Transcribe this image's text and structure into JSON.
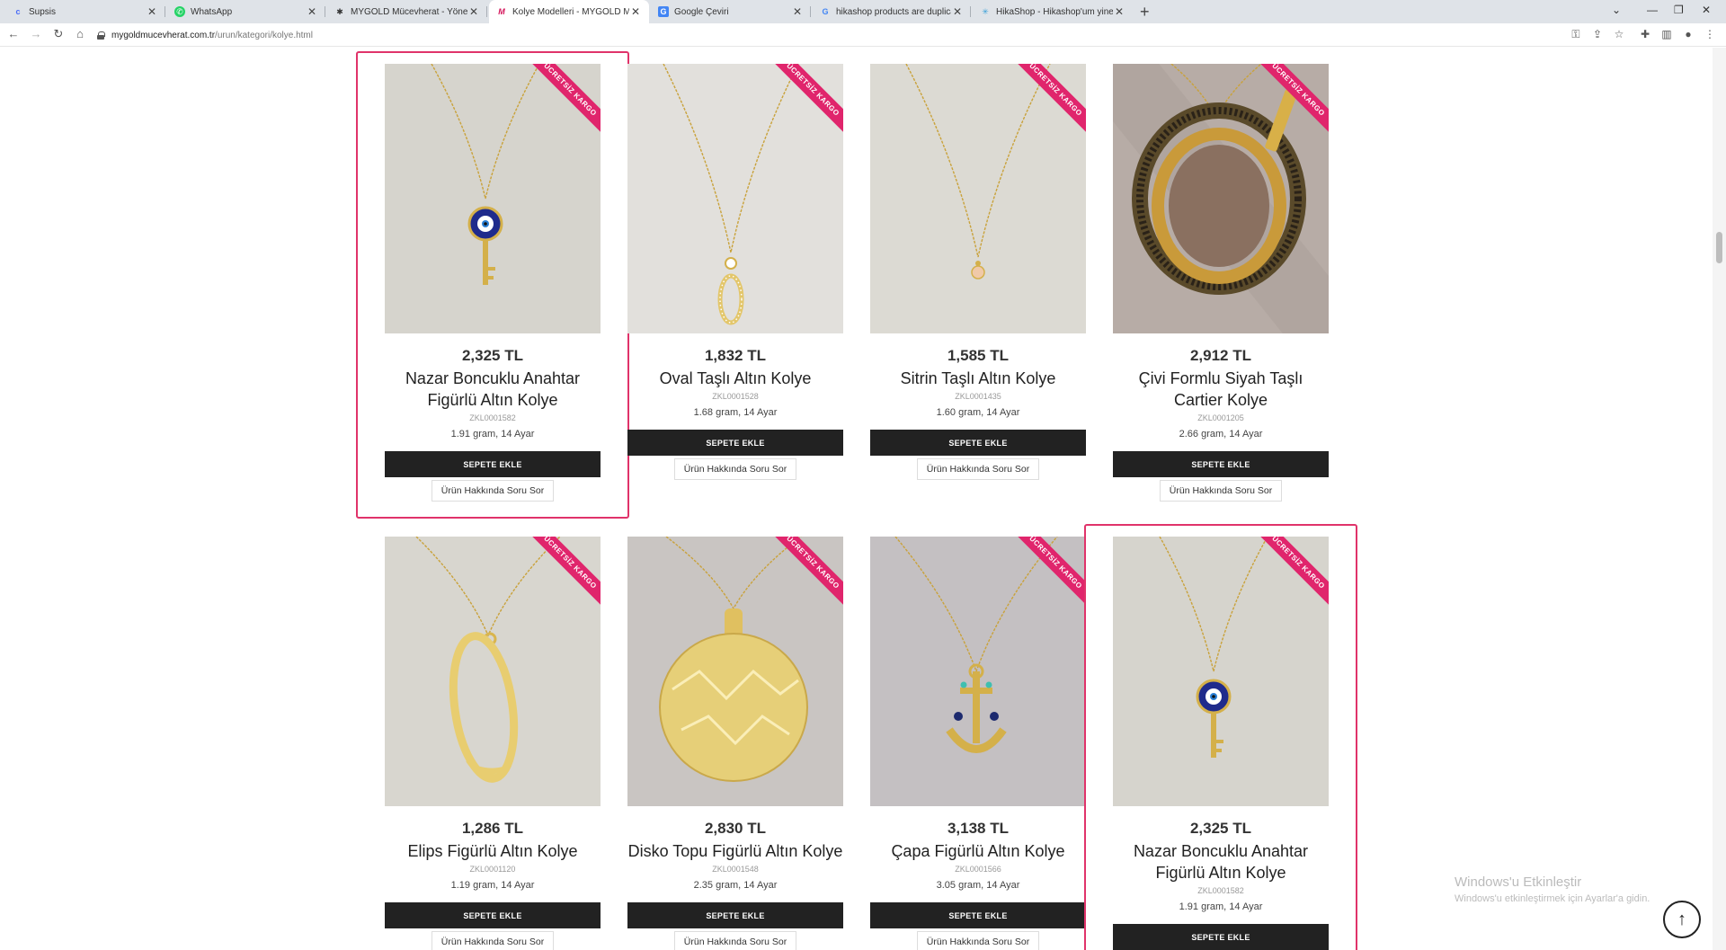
{
  "browser": {
    "tabs": [
      {
        "title": "Supsis",
        "icon": "supsis-favicon",
        "color": "#4a6cf7"
      },
      {
        "title": "WhatsApp",
        "icon": "whatsapp-favicon",
        "color": "#25d366"
      },
      {
        "title": "MYGOLD Mücevherat - Yönetim",
        "icon": "joomla-favicon",
        "color": "#333333"
      },
      {
        "title": "Kolye Modelleri - MYGOLD Mücevherat",
        "icon": "mygold-favicon",
        "color": "#d4145a"
      },
      {
        "title": "Google Çeviri",
        "icon": "google-translate-favicon",
        "color": "#4285f4"
      },
      {
        "title": "hikashop products are duplicated",
        "icon": "google-favicon",
        "color": "#4285f4"
      },
      {
        "title": "HikaShop - Hikashop'um yineleniyor",
        "icon": "hikashop-favicon",
        "color": "#3ba0d8"
      }
    ],
    "new_tab": "+",
    "url_host": "mygoldmucevherat.com.tr",
    "url_path": "/urun/kategori/kolye.html"
  },
  "product_rows": [
    [
      {
        "price": "2,325 TL",
        "title": "Nazar Boncuklu Anahtar Figürlü Altın Kolye",
        "sku": "ZKL0001582",
        "weight": "1.91 gram, 14 Ayar",
        "image": "evil-eye-key",
        "highlighted": true
      },
      {
        "price": "1,832 TL",
        "title": "Oval Taşlı Altın Kolye",
        "sku": "ZKL0001528",
        "weight": "1.68 gram, 14 Ayar",
        "image": "oval-stone",
        "highlighted": false
      },
      {
        "price": "1,585 TL",
        "title": "Sitrin Taşlı Altın Kolye",
        "sku": "ZKL0001435",
        "weight": "1.60 gram, 14 Ayar",
        "image": "citrine-drop",
        "highlighted": false
      },
      {
        "price": "2,912 TL",
        "title": "Çivi Formlu Siyah Taşlı Cartier Kolye",
        "sku": "ZKL0001205",
        "weight": "2.66 gram, 14 Ayar",
        "image": "nail-ring",
        "highlighted": false
      }
    ],
    [
      {
        "price": "1,286 TL",
        "title": "Elips Figürlü Altın Kolye",
        "sku": "ZKL0001120",
        "weight": "1.19 gram, 14 Ayar",
        "image": "ellipse",
        "highlighted": false
      },
      {
        "price": "2,830 TL",
        "title": "Disko Topu Figürlü Altın Kolye",
        "sku": "ZKL0001548",
        "weight": "2.35 gram, 14 Ayar",
        "image": "disco-ball",
        "highlighted": false
      },
      {
        "price": "3,138 TL",
        "title": "Çapa Figürlü Altın Kolye",
        "sku": "ZKL0001566",
        "weight": "3.05 gram, 14 Ayar",
        "image": "anchor",
        "highlighted": false
      },
      {
        "price": "2,325 TL",
        "title": "Nazar Boncuklu Anahtar Figürlü Altın Kolye",
        "sku": "ZKL0001582",
        "weight": "1.91 gram, 14 Ayar",
        "image": "evil-eye-key",
        "highlighted": true
      }
    ]
  ],
  "labels": {
    "ribbon": "ÜCRETSİZ KARGO",
    "add_to_cart": "SEPETE EKLE",
    "ask_question": "Ürün Hakkında Soru Sor"
  },
  "windows_activation": {
    "title": "Windows'u Etkinleştir",
    "subtitle": "Windows'u etkinleştirmek için Ayarlar'a gidin."
  },
  "colors": {
    "accent": "#e0256c",
    "highlight_border": "#e0336a",
    "button_dark": "#222222"
  }
}
